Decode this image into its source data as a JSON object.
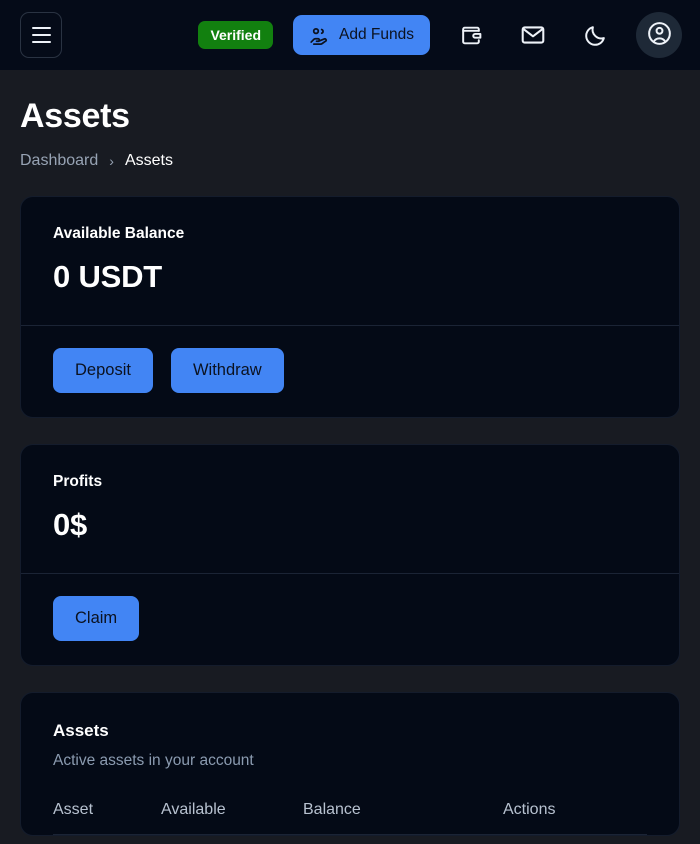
{
  "header": {
    "menu_icon": "hamburger-menu-icon",
    "verified_label": "Verified",
    "add_funds_label": "Add Funds",
    "add_funds_icon": "hand-coins-icon",
    "wallet_icon": "wallet-icon",
    "mail_icon": "mail-icon",
    "theme_icon": "moon-icon",
    "avatar_icon": "user-circle-icon",
    "colors": {
      "verified_green": "#12800f",
      "accent_blue": "#4285f4",
      "header_bg": "#050b18",
      "avatar_bg": "#1e2937"
    }
  },
  "page": {
    "title": "Assets",
    "breadcrumb": {
      "parent": "Dashboard",
      "separator": "›",
      "current": "Assets"
    },
    "background": "#181b22",
    "card_background": "#040a16"
  },
  "balance_card": {
    "label": "Available Balance",
    "value": "0 USDT",
    "deposit_label": "Deposit",
    "withdraw_label": "Withdraw"
  },
  "profits_card": {
    "label": "Profits",
    "value": "0$",
    "claim_label": "Claim"
  },
  "assets_card": {
    "title": "Assets",
    "subtitle": "Active assets in your account",
    "columns": [
      "Asset",
      "Available",
      "Balance",
      "Actions"
    ],
    "rows": []
  }
}
